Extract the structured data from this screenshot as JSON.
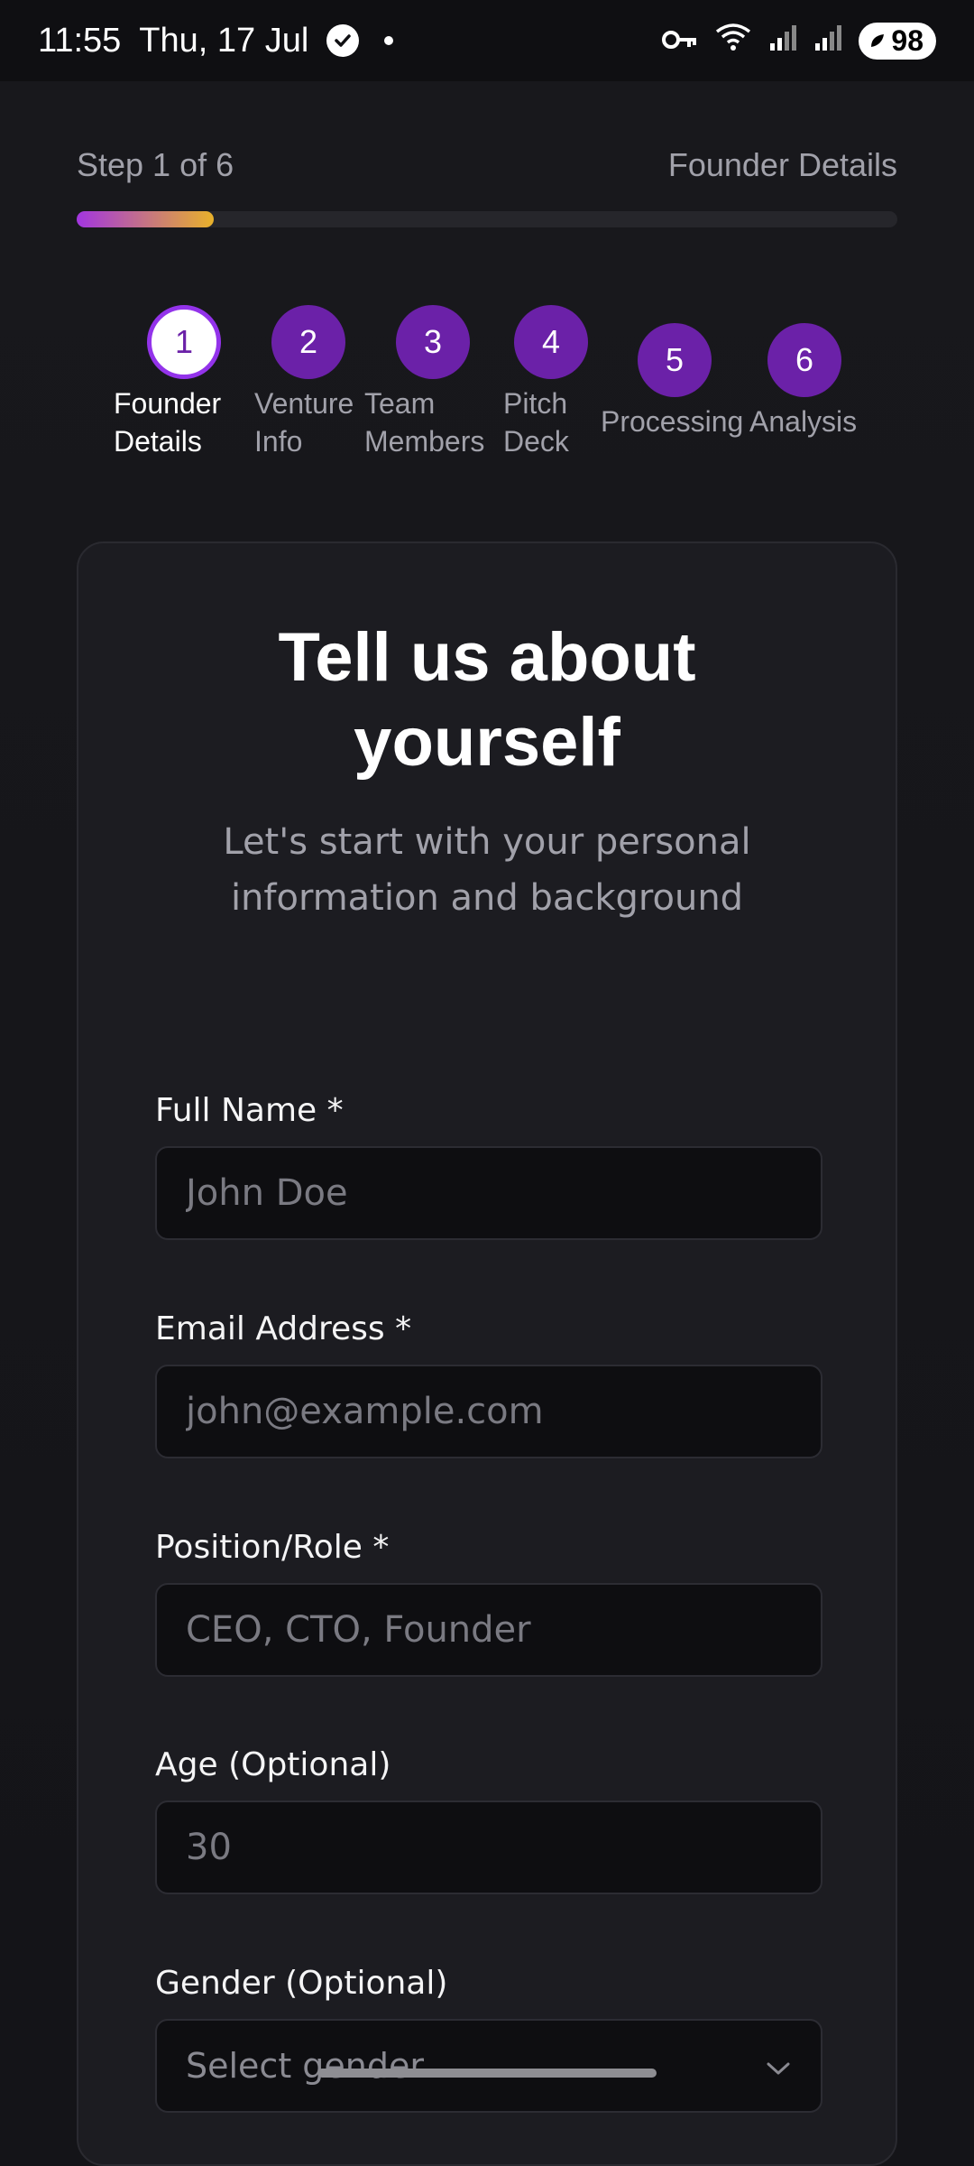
{
  "status_bar": {
    "time": "11:55",
    "date": "Thu, 17 Jul",
    "battery": "98"
  },
  "progress": {
    "step_text": "Step 1 of 6",
    "current_title": "Founder Details",
    "fraction": 0.1667
  },
  "steps": [
    {
      "number": "1",
      "label": "Founder Details",
      "active": true
    },
    {
      "number": "2",
      "label": "Venture Info",
      "active": false
    },
    {
      "number": "3",
      "label": "Team Members",
      "active": false
    },
    {
      "number": "4",
      "label": "Pitch Deck",
      "active": false
    },
    {
      "number": "5",
      "label": "Processing",
      "active": false
    },
    {
      "number": "6",
      "label": "Analysis",
      "active": false
    }
  ],
  "card": {
    "title": "Tell us about yourself",
    "subtitle": "Let's start with your personal information and background"
  },
  "form": {
    "full_name": {
      "label": "Full Name *",
      "placeholder": "John Doe",
      "value": ""
    },
    "email": {
      "label": "Email Address *",
      "placeholder": "john@example.com",
      "value": ""
    },
    "position": {
      "label": "Position/Role *",
      "placeholder": "CEO, CTO, Founder",
      "value": ""
    },
    "age": {
      "label": "Age (Optional)",
      "placeholder": "30",
      "value": ""
    },
    "gender": {
      "label": "Gender (Optional)",
      "placeholder": "Select gender"
    }
  },
  "colors": {
    "accent_purple": "#6b21a8",
    "gradient_start": "#a235e0",
    "gradient_end": "#e8b12a",
    "background": "#141418",
    "card": "#1c1c21"
  },
  "icons": [
    "check-badge-icon",
    "key-icon",
    "wifi-icon",
    "signal-icon",
    "battery-icon",
    "chevron-down-icon"
  ]
}
